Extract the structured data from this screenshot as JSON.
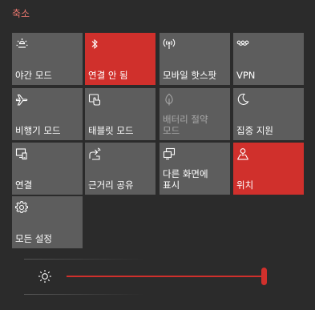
{
  "header": {
    "collapse_label": "축소"
  },
  "tiles": [
    {
      "label": "야간 모드",
      "icon": "brightness-icon",
      "active": false
    },
    {
      "label": "연결 안 됨",
      "icon": "bluetooth-icon",
      "active": true
    },
    {
      "label": "모바일 핫스팟",
      "icon": "mobile-hotspot-icon",
      "active": false
    },
    {
      "label": "VPN",
      "icon": "vpn-icon",
      "active": false
    },
    {
      "label": "비행기 모드",
      "icon": "airplane-icon",
      "active": false
    },
    {
      "label": "태블릿 모드",
      "icon": "tablet-mode-icon",
      "active": false
    },
    {
      "label": "배터리 절약 모드",
      "icon": "battery-saver-icon",
      "active": false,
      "disabled": true
    },
    {
      "label": "집중 지원",
      "icon": "moon-icon",
      "active": false
    },
    {
      "label": "연결",
      "icon": "connect-icon",
      "active": false
    },
    {
      "label": "근거리 공유",
      "icon": "nearby-share-icon",
      "active": false
    },
    {
      "label": "다른 화면에 표시",
      "icon": "project-icon",
      "active": false
    },
    {
      "label": "위치",
      "icon": "location-icon",
      "active": true
    },
    {
      "label": "모든 설정",
      "icon": "gear-icon",
      "active": false
    }
  ],
  "brightness": {
    "icon": "brightness-icon",
    "level": 1.0
  },
  "colors": {
    "accent": "#d0302c",
    "tile_bg": "#5d5d5d",
    "panel_bg": "#2b2b2b",
    "collapse_text": "#e8776e"
  }
}
